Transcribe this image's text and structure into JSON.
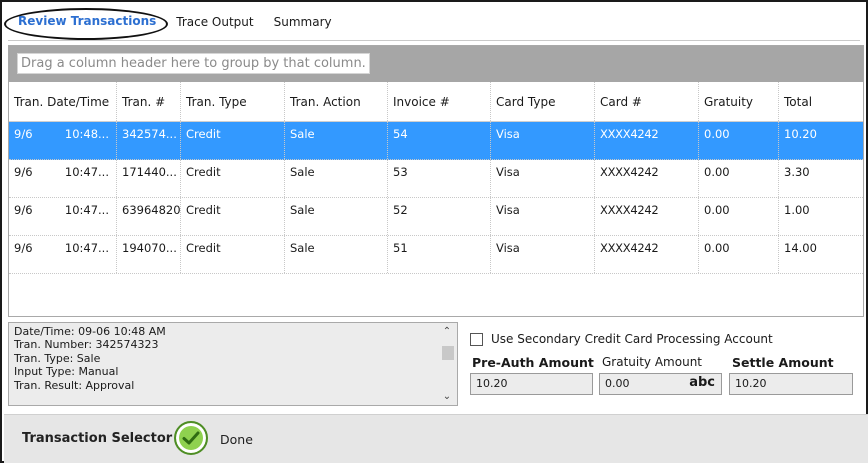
{
  "tabs": [
    {
      "label": "Review Transactions",
      "active": true
    },
    {
      "label": "Trace Output",
      "active": false
    },
    {
      "label": "Summary",
      "active": false
    }
  ],
  "grid": {
    "group_prompt": "Drag a column header here to group by that column.",
    "columns": [
      "Tran. Date/Time",
      "Tran. #",
      "Tran. Type",
      "Tran. Action",
      "Invoice #",
      "Card Type",
      "Card #",
      "Gratuity",
      "Total"
    ],
    "rows": [
      {
        "date": "9/6",
        "time": "10:48...",
        "tran_num": "342574...",
        "type": "Credit",
        "action": "Sale",
        "invoice": "54",
        "card_type": "Visa",
        "card_num": "XXXX4242",
        "gratuity": "0.00",
        "total": "10.20",
        "selected": true
      },
      {
        "date": "9/6",
        "time": "10:47...",
        "tran_num": "171440...",
        "type": "Credit",
        "action": "Sale",
        "invoice": "53",
        "card_type": "Visa",
        "card_num": "XXXX4242",
        "gratuity": "0.00",
        "total": "3.30",
        "selected": false
      },
      {
        "date": "9/6",
        "time": "10:47...",
        "tran_num": "63964820",
        "type": "Credit",
        "action": "Sale",
        "invoice": "52",
        "card_type": "Visa",
        "card_num": "XXXX4242",
        "gratuity": "0.00",
        "total": "1.00",
        "selected": false
      },
      {
        "date": "9/6",
        "time": "10:47...",
        "tran_num": "194070...",
        "type": "Credit",
        "action": "Sale",
        "invoice": "51",
        "card_type": "Visa",
        "card_num": "XXXX4242",
        "gratuity": "0.00",
        "total": "14.00",
        "selected": false
      }
    ]
  },
  "details": {
    "lines": [
      "Date/Time: 09-06 10:48 AM",
      "Tran. Number: 342574323",
      "Tran. Type: Sale",
      "Input Type: Manual",
      "Tran. Result: Approval"
    ]
  },
  "options": {
    "secondary_account_label": "Use Secondary Credit Card Processing Account",
    "secondary_account_checked": false
  },
  "amounts": {
    "preauth_label": "Pre-Auth Amount",
    "preauth_value": "10.20",
    "gratuity_label": "Gratuity Amount",
    "gratuity_value": "0.00",
    "gratuity_keyboard": "abc",
    "settle_label": "Settle Amount",
    "settle_value": "10.20"
  },
  "footer": {
    "title": "Transaction Selector",
    "done_label": "Done"
  },
  "colors": {
    "selected_row": "#3399ff",
    "active_tab": "#2c6fd1",
    "group_panel": "#a6a6a6",
    "done_icon": "#8fd14f"
  },
  "icons": {
    "done": "check-circle-icon",
    "scroll_up": "chevron-up-icon",
    "scroll_down": "chevron-down-icon"
  }
}
